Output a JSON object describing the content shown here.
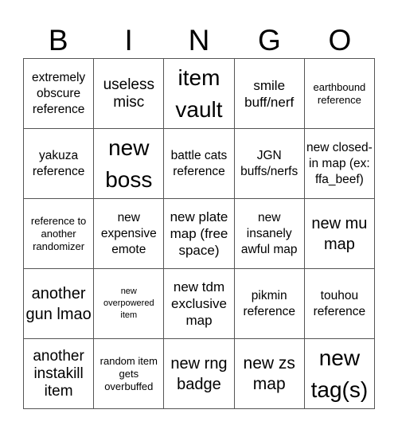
{
  "header": {
    "letters": [
      "B",
      "I",
      "N",
      "G",
      "O"
    ]
  },
  "cells": [
    [
      "extremely obscure reference",
      "useless misc",
      "item vault",
      "smile buff/nerf",
      "earthbound reference"
    ],
    [
      "yakuza reference",
      "new boss",
      "battle cats reference",
      "JGN buffs/nerfs",
      "new closed-in map (ex: ffa_beef)"
    ],
    [
      "reference to another randomizer",
      "new expensive emote",
      "new plate map (free space)",
      "new insanely awful map",
      "new mu map"
    ],
    [
      "another gun lmao",
      "new overpowered item",
      "new tdm exclusive map",
      "pikmin reference",
      "touhou reference"
    ],
    [
      "another instakill item",
      "random item gets overbuffed",
      "new rng badge",
      "new zs map",
      "new tag(s)"
    ]
  ]
}
